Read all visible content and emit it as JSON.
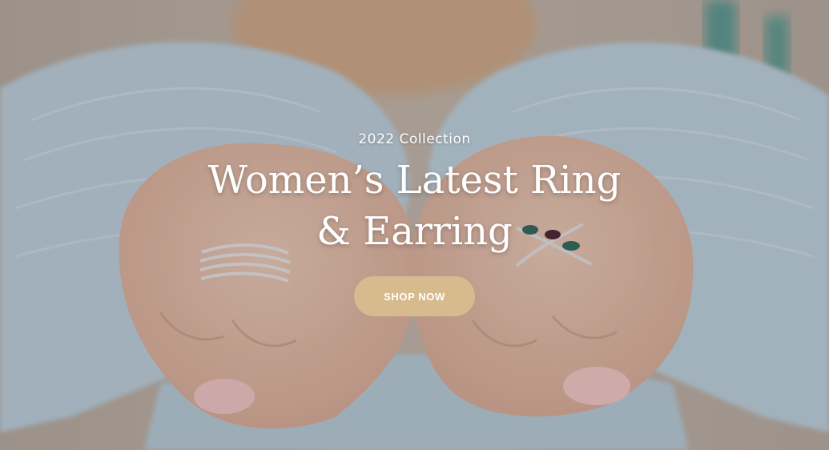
{
  "hero": {
    "eyebrow": "2022 Collection",
    "headline_line1": "Women’s Latest Ring",
    "headline_line2": "& Earring",
    "cta_label": "SHOP NOW"
  },
  "colors": {
    "cta_background": "#d7bb8e",
    "text": "#ffffff"
  }
}
